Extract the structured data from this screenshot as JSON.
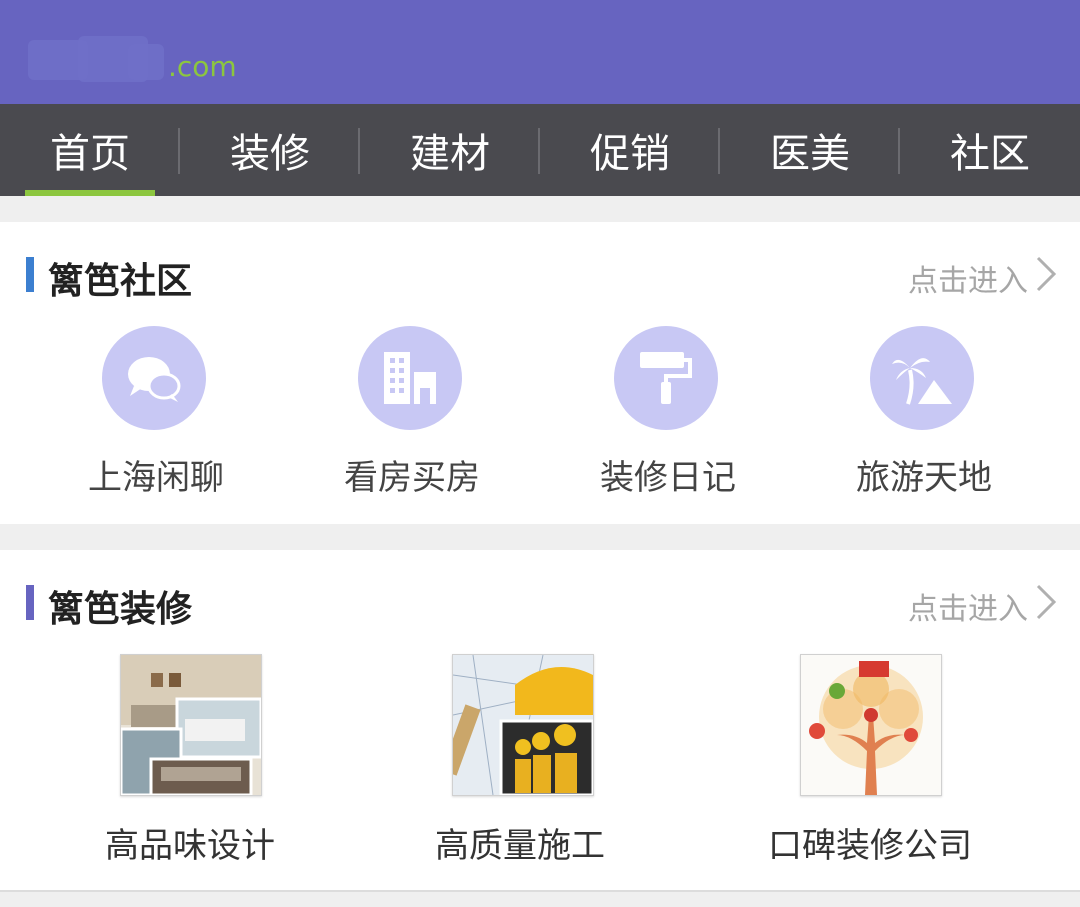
{
  "header": {
    "logo_suffix": ".com",
    "bg_color": "#6764c0",
    "accent_color": "#8cc63f"
  },
  "nav": {
    "items": [
      {
        "label": "首页",
        "active": true
      },
      {
        "label": "装修",
        "active": false
      },
      {
        "label": "建材",
        "active": false
      },
      {
        "label": "促销",
        "active": false
      },
      {
        "label": "医美",
        "active": false
      },
      {
        "label": "社区",
        "active": false
      }
    ]
  },
  "community": {
    "title": "篱笆社区",
    "more_label": "点击进入",
    "bar_color": "#3c7fd0",
    "items": [
      {
        "label": "上海闲聊",
        "icon": "chat-bubbles-icon"
      },
      {
        "label": "看房买房",
        "icon": "buildings-icon"
      },
      {
        "label": "装修日记",
        "icon": "paint-roller-icon"
      },
      {
        "label": "旅游天地",
        "icon": "palm-tree-icon"
      }
    ]
  },
  "decoration": {
    "title": "篱笆装修",
    "more_label": "点击进入",
    "bar_color": "#6764c0",
    "items": [
      {
        "label": "高品味设计",
        "image": "interior-design-thumbnail"
      },
      {
        "label": "高质量施工",
        "image": "construction-workers-thumbnail"
      },
      {
        "label": "口碑装修公司",
        "image": "tree-logo-thumbnail"
      }
    ]
  }
}
